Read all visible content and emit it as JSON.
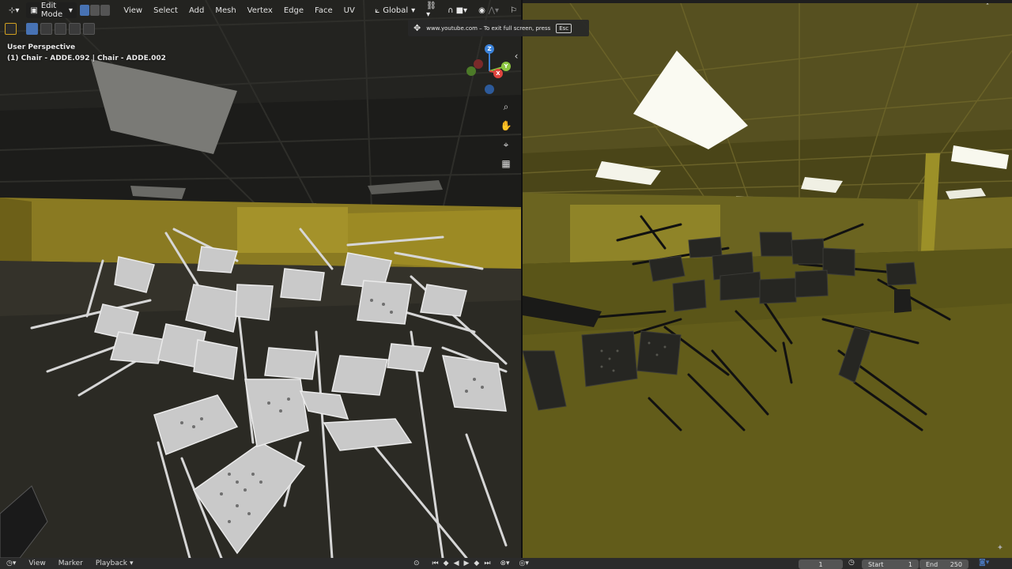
{
  "header": {
    "mode_label": "Edit Mode",
    "menu": [
      "View",
      "Select",
      "Add",
      "Mesh",
      "Vertex",
      "Edge",
      "Face",
      "UV"
    ],
    "orientation_label": "Global"
  },
  "viewport": {
    "perspective_label": "User Perspective",
    "object_label": "(1) Chair - ADDE.092 | Chair - ADDE.002",
    "gizmo": {
      "z": "Z",
      "y": "Y",
      "x": "X"
    }
  },
  "fullscreen_notice": {
    "text": "www.youtube.com – To exit full screen, press",
    "key": "Esc"
  },
  "timeline": {
    "view_label": "View",
    "marker_label": "Marker",
    "playback_label": "Playback",
    "current_frame": "1",
    "start_label": "Start",
    "start_value": "1",
    "end_label": "End",
    "end_value": "250"
  },
  "colors": {
    "accent_blue": "#4772b3",
    "axis_x": "#e0443e",
    "axis_y": "#8bc540",
    "axis_z": "#3b82d9",
    "wall_yellow": "#c8b530"
  }
}
